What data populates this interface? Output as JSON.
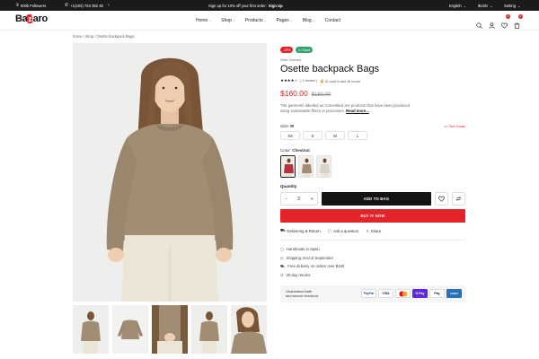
{
  "topbar": {
    "followers": "500k Followers",
    "phone": "+1(403) 763 392 46",
    "promo_text": "Sign up for 10% off your first order:",
    "promo_link": "Sign Up",
    "language": "English",
    "currency": "$USD",
    "setting": "Setting"
  },
  "header": {
    "logo_pre": "Ba",
    "logo_z": "z",
    "logo_post": "aro",
    "nav": [
      "Home",
      "Shop",
      "Products",
      "Pages",
      "Blog",
      "Contact"
    ],
    "wishlist_count": "0",
    "cart_count": "0"
  },
  "breadcrumb": "home / shop / Osette backpack Bags",
  "product": {
    "sale_badge": "-15%",
    "stock_badge": "In Stock",
    "category": "Girls Clothes",
    "title": "Osette backpack Bags",
    "stars": "★★★★☆",
    "reviews": "( 1 review )",
    "sold_text": "41 sold in last 16 hours",
    "price": "$160.00",
    "old_price": "$180.00",
    "description": "The garments labelled as Committed are products that have been produced using sustainable fibres or processes.",
    "read_more": "Read more...",
    "size_label": "Size:",
    "size_value": "M",
    "size_guide": "Size Guide",
    "sizes": [
      "XS",
      "S",
      "M",
      "L"
    ],
    "color_label": "Color:",
    "color_value": "Chestnut",
    "quantity_label": "Quantity",
    "quantity": "2",
    "add_to_bag": "ADD TO BAG",
    "buy_now": "BUY IT NOW",
    "links": [
      "Delivering & Return",
      "Ask a question",
      "Share"
    ],
    "features": [
      "Handmade in Spain",
      "Shipping: End of September",
      "Free delivery on orders over $150",
      "30-day returns"
    ],
    "checkout_text_1": "Guaranteed safe",
    "checkout_text_2": "and secure checkout",
    "payments": [
      "PayPal",
      "VISA",
      "MC",
      "G Pay",
      "Pay",
      "AMEX"
    ]
  },
  "colors": {
    "accent": "#e3242b",
    "dark": "#141414",
    "sweater": "#a08d74",
    "jeans": "#ebe5d6"
  }
}
